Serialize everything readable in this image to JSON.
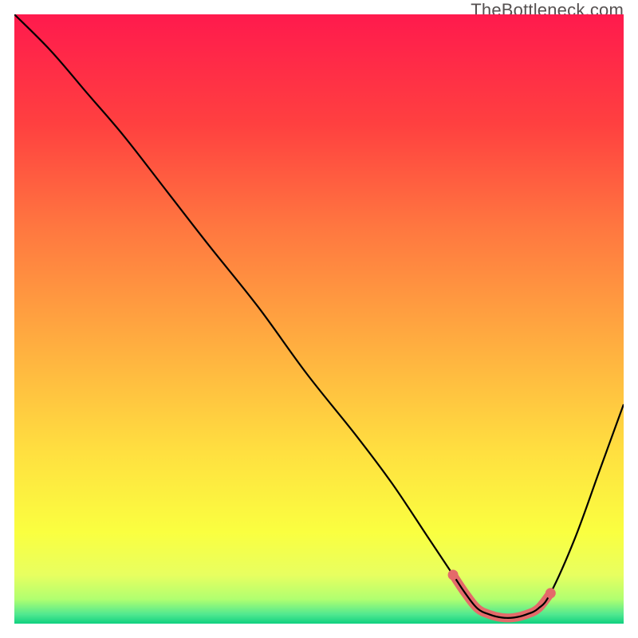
{
  "watermark": "TheBottleneck.com",
  "chart_data": {
    "type": "line",
    "title": "",
    "xlabel": "",
    "ylabel": "",
    "xlim": [
      0,
      100
    ],
    "ylim": [
      0,
      100
    ],
    "x": [
      0,
      6,
      12,
      18,
      25,
      32,
      40,
      48,
      56,
      62,
      68,
      72,
      74,
      76,
      78,
      80,
      82,
      84,
      86,
      88,
      92,
      96,
      100
    ],
    "values": [
      100,
      94,
      87,
      80,
      71,
      62,
      52,
      41,
      31,
      23,
      14,
      8,
      5,
      2.5,
      1.5,
      1,
      1,
      1.5,
      2.5,
      5,
      14,
      25,
      36
    ],
    "highlight_range_x": [
      72,
      88
    ],
    "gradient_stops": [
      {
        "pos": 0.0,
        "color": "#ff1a4d"
      },
      {
        "pos": 0.18,
        "color": "#ff4040"
      },
      {
        "pos": 0.35,
        "color": "#ff7740"
      },
      {
        "pos": 0.55,
        "color": "#ffb040"
      },
      {
        "pos": 0.72,
        "color": "#ffe040"
      },
      {
        "pos": 0.85,
        "color": "#faff40"
      },
      {
        "pos": 0.92,
        "color": "#e8ff60"
      },
      {
        "pos": 0.96,
        "color": "#b0ff70"
      },
      {
        "pos": 0.985,
        "color": "#50e890"
      },
      {
        "pos": 1.0,
        "color": "#10d080"
      }
    ],
    "curve_color": "#000000",
    "highlight_color": "#e46a6a"
  }
}
